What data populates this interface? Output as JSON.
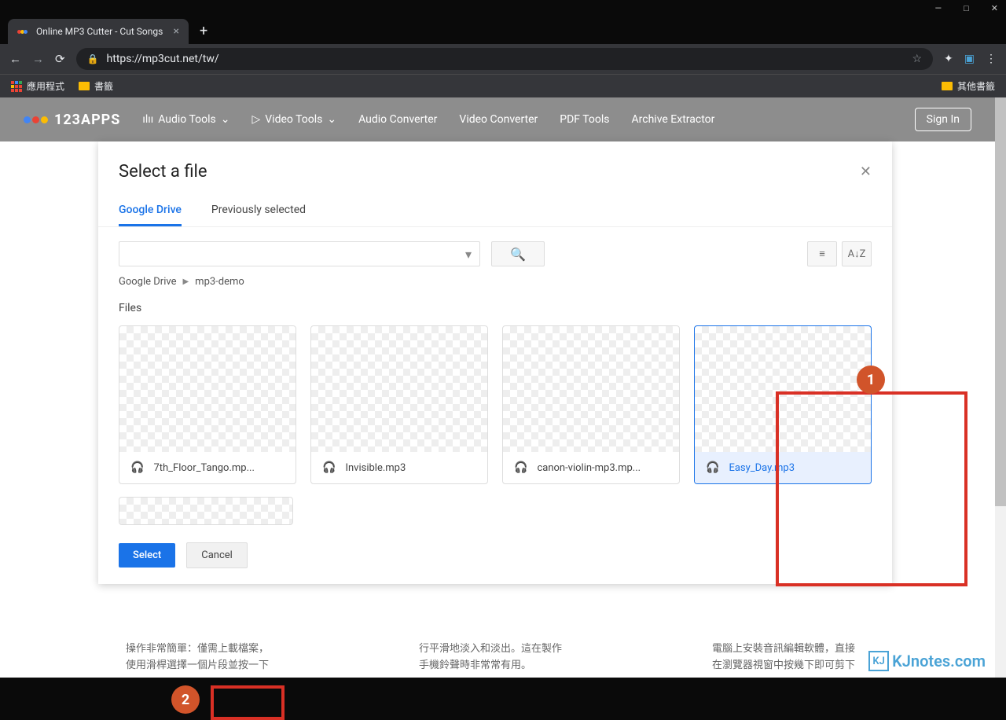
{
  "browser": {
    "tab_title": "Online MP3 Cutter - Cut Songs",
    "url": "https://mp3cut.net/tw/",
    "bookmarks": {
      "apps": "應用程式",
      "folder1": "書籤",
      "other": "其他書籤"
    }
  },
  "nav": {
    "brand": "123APPS",
    "items": [
      "Audio Tools",
      "Video Tools",
      "Audio Converter",
      "Video Converter",
      "PDF Tools",
      "Archive Extractor"
    ],
    "signin": "Sign In"
  },
  "modal": {
    "title": "Select a file",
    "tabs": {
      "active": "Google Drive",
      "other": "Previously selected"
    },
    "breadcrumb": {
      "root": "Google Drive",
      "folder": "mp3-demo"
    },
    "files_label": "Files",
    "files": [
      {
        "name": "7th_Floor_Tango.mp...",
        "selected": false
      },
      {
        "name": "Invisible.mp3",
        "selected": false
      },
      {
        "name": "canon-violin-mp3.mp...",
        "selected": false
      },
      {
        "name": "Easy_Day.mp3",
        "selected": true
      }
    ],
    "buttons": {
      "select": "Select",
      "cancel": "Cancel"
    }
  },
  "annotations": {
    "badge1": "1",
    "badge2": "2"
  },
  "bg_text": {
    "col1a": "操作非常簡單：僅需上載檔案，",
    "col1b": "使用滑桿選擇一個片段並按一下",
    "col2a": "行平滑地淡入和淡出。這在製作",
    "col2b": "手機鈴聲時非常常有用。",
    "col3a": "電腦上安裝音訊編輯軟體，直接",
    "col3b": "在瀏覽器視窗中按幾下即可剪下"
  },
  "watermark": "KJnotes.com"
}
